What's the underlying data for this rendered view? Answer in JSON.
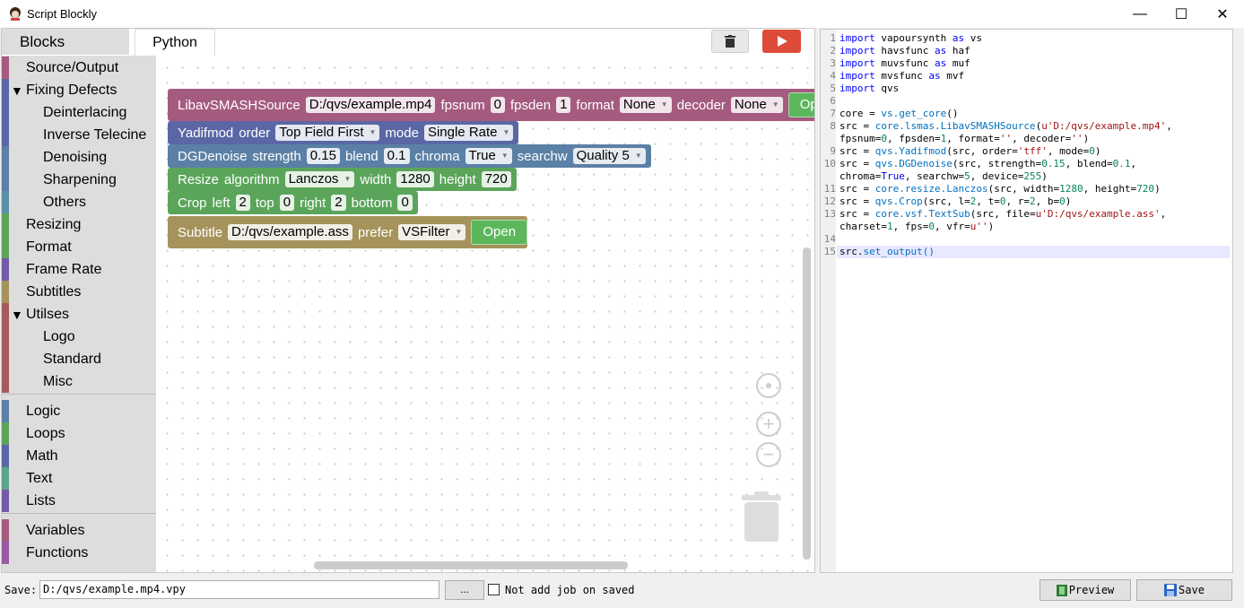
{
  "window": {
    "title": "Script Blockly",
    "minimize": "—",
    "maximize": "☐",
    "close": "✕"
  },
  "tabs": {
    "blocks": "Blocks",
    "python": "Python"
  },
  "toolbox": [
    {
      "label": "Source/Output",
      "color": "#a55b80",
      "indent": 0,
      "arrow": ""
    },
    {
      "label": "Fixing Defects",
      "color": "#5b67a5",
      "indent": 0,
      "arrow": "▼"
    },
    {
      "label": "Deinterlacing",
      "color": "#5b67a5",
      "indent": 1,
      "arrow": ""
    },
    {
      "label": "Inverse Telecine",
      "color": "#5b67a5",
      "indent": 1,
      "arrow": ""
    },
    {
      "label": "Denoising",
      "color": "#5b80a5",
      "indent": 1,
      "arrow": ""
    },
    {
      "label": "Sharpening",
      "color": "#5b80a5",
      "indent": 1,
      "arrow": ""
    },
    {
      "label": "Others",
      "color": "#5b8fa5",
      "indent": 1,
      "arrow": ""
    },
    {
      "label": "Resizing",
      "color": "#5ba55b",
      "indent": 0,
      "arrow": ""
    },
    {
      "label": "Format",
      "color": "#5ba55b",
      "indent": 0,
      "arrow": ""
    },
    {
      "label": "Frame Rate",
      "color": "#745ba5",
      "indent": 0,
      "arrow": ""
    },
    {
      "label": "Subtitles",
      "color": "#a5935b",
      "indent": 0,
      "arrow": ""
    },
    {
      "label": "Utilses",
      "color": "#a55b5b",
      "indent": 0,
      "arrow": "▼"
    },
    {
      "label": "Logo",
      "color": "#a55b5b",
      "indent": 1,
      "arrow": ""
    },
    {
      "label": "Standard",
      "color": "#a55b5b",
      "indent": 1,
      "arrow": ""
    },
    {
      "label": "Misc",
      "color": "#a55b5b",
      "indent": 1,
      "arrow": ""
    },
    {
      "label": "Logic",
      "color": "#5b80a5",
      "indent": 0,
      "arrow": ""
    },
    {
      "label": "Loops",
      "color": "#5ba55b",
      "indent": 0,
      "arrow": ""
    },
    {
      "label": "Math",
      "color": "#5b67a5",
      "indent": 0,
      "arrow": ""
    },
    {
      "label": "Text",
      "color": "#5ba58c",
      "indent": 0,
      "arrow": ""
    },
    {
      "label": "Lists",
      "color": "#745ba5",
      "indent": 0,
      "arrow": ""
    },
    {
      "label": "Variables",
      "color": "#a55b80",
      "indent": 0,
      "arrow": ""
    },
    {
      "label": "Functions",
      "color": "#995ba5",
      "indent": 0,
      "arrow": ""
    }
  ],
  "blocks": [
    {
      "name": "source",
      "color": "#a55b80",
      "parts": [
        {
          "t": "LibavSMASHSource"
        },
        {
          "f": "D:/qvs/example.mp4"
        },
        {
          "t": "fpsnum"
        },
        {
          "f": "0"
        },
        {
          "t": "fpsden"
        },
        {
          "f": "1"
        },
        {
          "t": "format"
        },
        {
          "d": "None"
        },
        {
          "t": "decoder"
        },
        {
          "d": "None"
        },
        {
          "b": "Open"
        }
      ]
    },
    {
      "name": "yadifmod",
      "color": "#5b67a5",
      "parts": [
        {
          "t": "Yadifmod"
        },
        {
          "t": "order"
        },
        {
          "d": "Top Field First"
        },
        {
          "t": "mode"
        },
        {
          "d": "Single Rate"
        }
      ]
    },
    {
      "name": "dgdenoise",
      "color": "#5b80a5",
      "parts": [
        {
          "t": "DGDenoise"
        },
        {
          "t": "strength"
        },
        {
          "f": "0.15"
        },
        {
          "t": "blend"
        },
        {
          "f": "0.1"
        },
        {
          "t": "chroma"
        },
        {
          "d": "True"
        },
        {
          "t": "searchw"
        },
        {
          "d": "Quality 5"
        }
      ]
    },
    {
      "name": "resize",
      "color": "#5ba55b",
      "parts": [
        {
          "t": "Resize"
        },
        {
          "t": "algorithm"
        },
        {
          "d": "Lanczos"
        },
        {
          "t": "width"
        },
        {
          "f": "1280"
        },
        {
          "t": "height"
        },
        {
          "f": "720"
        }
      ]
    },
    {
      "name": "crop",
      "color": "#5ba55b",
      "parts": [
        {
          "t": "Crop"
        },
        {
          "t": "left"
        },
        {
          "f": "2"
        },
        {
          "t": "top"
        },
        {
          "f": "0"
        },
        {
          "t": "right"
        },
        {
          "f": "2"
        },
        {
          "t": "bottom"
        },
        {
          "f": "0"
        }
      ]
    },
    {
      "name": "subtitle",
      "color": "#a5935b",
      "parts": [
        {
          "t": "Subtitle"
        },
        {
          "f": "D:/qvs/example.ass"
        },
        {
          "t": "prefer"
        },
        {
          "d": "VSFilter"
        },
        {
          "b": "Open"
        }
      ]
    }
  ],
  "code": {
    "line_numbers": [
      "1",
      "2",
      "3",
      "4",
      "5",
      "6",
      "7",
      "8",
      "",
      "9",
      "10",
      "",
      "11",
      "12",
      "13",
      "",
      "14",
      "15"
    ],
    "lines": [
      "import vapoursynth as vs",
      "import havsfunc as haf",
      "import muvsfunc as muf",
      "import mvsfunc as mvf",
      "import qvs",
      "",
      "core = vs.get_core()",
      "src = core.lsmas.LibavSMASHSource(u'D:/qvs/example.mp4',",
      "fpsnum=0, fpsden=1, format='', decoder='')",
      "src = qvs.Yadifmod(src, order='tff', mode=0)",
      "src = qvs.DGDenoise(src, strength=0.15, blend=0.1,",
      "chroma=True, searchw=5, device=255)",
      "src = core.resize.Lanczos(src, width=1280, height=720)",
      "src = qvs.Crop(src, l=2, t=0, r=2, b=0)",
      "src = core.vsf.TextSub(src, file=u'D:/qvs/example.ass',",
      "charset=1, fps=0, vfr=u'')",
      "",
      "src.set_output()"
    ]
  },
  "bottom": {
    "save_label": "Save:",
    "save_path": "D:/qvs/example.mp4.vpy",
    "browse": "...",
    "not_add_job": "Not add job on saved",
    "preview": "Preview",
    "save": "Save"
  }
}
